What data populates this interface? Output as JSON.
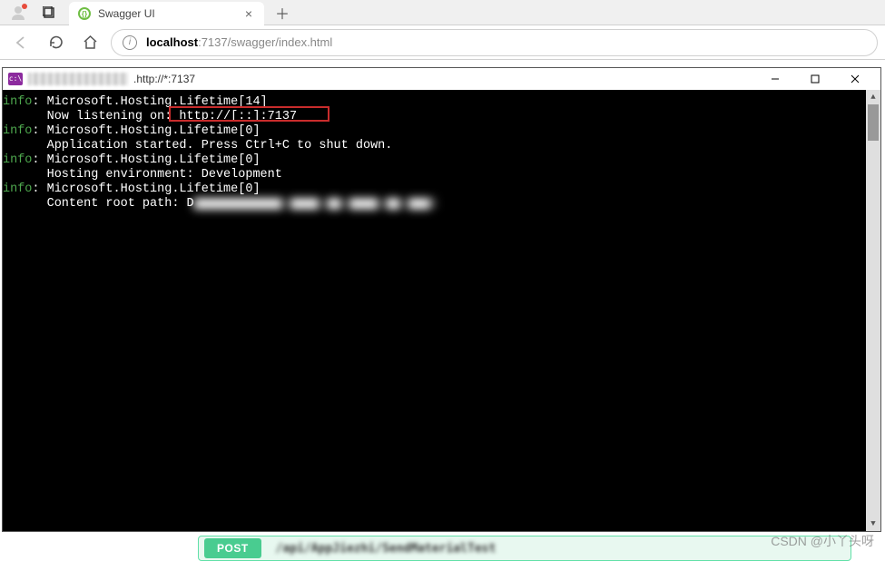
{
  "browser": {
    "tab": {
      "title": "Swagger UI",
      "favicon_color": "#6fbe44"
    },
    "url_host": "localhost",
    "url_port": ":7137",
    "url_path": "/swagger/index.html"
  },
  "console": {
    "title_suffix": ".http://*:7137",
    "icon_label": "c:\\",
    "lines": [
      {
        "level": "info",
        "source": "Microsoft.Hosting.Lifetime[14]",
        "text": "Now listening on: http://[::]:7137",
        "highlight_url": "http://[::]:7137"
      },
      {
        "level": "info",
        "source": "Microsoft.Hosting.Lifetime[0]",
        "text": "Application started. Press Ctrl+C to shut down."
      },
      {
        "level": "info",
        "source": "Microsoft.Hosting.Lifetime[0]",
        "text": "Hosting environment: Development"
      },
      {
        "level": "info",
        "source": "Microsoft.Hosting.Lifetime[0]",
        "text": "Content root path: D",
        "blurred_path": "▆▆▆▆▆▆▆▆▆▆▆▆ ▆▆▆▆ ▆▆ ▆▆▆▆ ▆▆ ▆▆▆i"
      }
    ],
    "win_minimize_glyph": "—",
    "win_maximize_glyph": "▢",
    "win_close_glyph": "✕"
  },
  "swagger": {
    "method": "POST",
    "path": "/api/AppJiezhi/SendMaterialTest"
  },
  "watermark": "CSDN @小丫头呀"
}
